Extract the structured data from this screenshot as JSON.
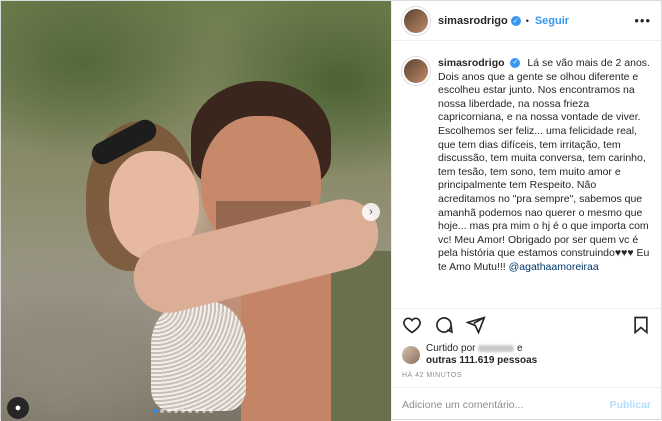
{
  "post": {
    "username": "simasrodrigo",
    "follow_label": "Seguir",
    "header_separator": "•",
    "more_label": "•••",
    "caption": "Lá se vão mais de 2 anos. Dois anos que a gente se olhou diferente e escolheu estar junto. Nos encontramos na nossa liberdade, na nossa frieza capricorniana, e na nossa vontade de viver. Escolhemos ser feliz... uma felicidade real, que tem dias difíceis, tem irritação, tem discussão, tem muita conversa, tem carinho, tem tesão, tem sono, tem muito amor e principalmente tem Respeito. Não acreditamos no \"pra sempre\", sabemos que amanhã podemos nao querer o mesmo que hoje... mas pra mim o hj é o que importa com vc! Meu Amor! Obrigado por ser quem vc é pela história que estamos construindo♥♥♥ Eu te Amo Mutu!!!",
    "mention": "@agathaamoreiraa",
    "likes": {
      "prefix": "Curtido por",
      "connector": "e",
      "others": "outras 111.619 pessoas"
    },
    "timestamp": "HÁ 42 MINUTOS",
    "carousel": {
      "count": 9,
      "active_index": 0,
      "next_icon": "chevron-right-icon"
    }
  },
  "comment_box": {
    "placeholder": "Adicione um comentário...",
    "publish_label": "Publicar"
  },
  "colors": {
    "accent": "#3897f0",
    "publish_disabled": "#b2dffc",
    "mention": "#00376b",
    "muted": "#8e8e8e"
  },
  "icons": [
    "heart-icon",
    "comment-icon",
    "share-icon",
    "bookmark-icon",
    "verified-badge-icon",
    "chevron-right-icon"
  ]
}
